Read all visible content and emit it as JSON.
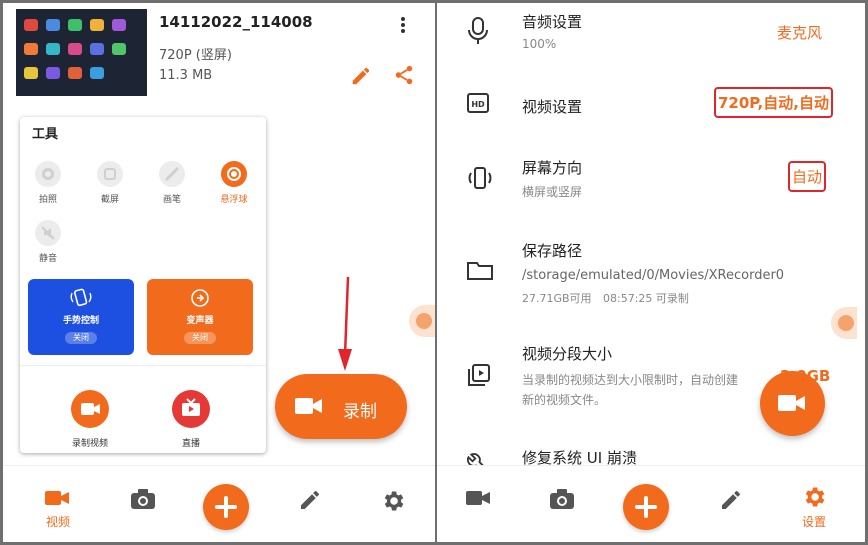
{
  "left": {
    "video": {
      "title": "14112022_114008",
      "resolution": "720P (竖屏)",
      "size": "11.3 MB"
    },
    "tools": {
      "title": "工具",
      "items": [
        {
          "label": "拍照",
          "icon": "camera-shutter-icon",
          "active": false
        },
        {
          "label": "截屏",
          "icon": "screenshot-icon",
          "active": false
        },
        {
          "label": "画笔",
          "icon": "brush-icon",
          "active": false
        },
        {
          "label": "悬浮球",
          "icon": "floating-ball-icon",
          "active": true
        },
        {
          "label": "静音",
          "icon": "mute-icon",
          "active": false
        }
      ],
      "cards": [
        {
          "label": "手势控制",
          "status": "关闭",
          "icon": "gesture-icon",
          "color": "#1d4fe0"
        },
        {
          "label": "变声器",
          "status": "关闭",
          "icon": "voice-changer-icon",
          "color": "#f26b1d"
        }
      ],
      "actions": [
        {
          "label": "录制视频",
          "icon": "record-video-icon",
          "color": "#f26b1d"
        },
        {
          "label": "直播",
          "icon": "live-tv-icon",
          "color": "#e53935"
        }
      ]
    },
    "record_button": {
      "label": "录制"
    },
    "nav": [
      {
        "label": "视频",
        "icon": "video-camera-icon",
        "active": true
      },
      {
        "label": "",
        "icon": "camera-icon",
        "active": false
      },
      {
        "label": "",
        "icon": "plus-icon",
        "active": false
      },
      {
        "label": "",
        "icon": "pencil-icon",
        "active": false
      },
      {
        "label": "",
        "icon": "gear-icon",
        "active": false
      }
    ]
  },
  "right": {
    "settings": [
      {
        "title": "音频设置",
        "subtitle": "100%",
        "value": "麦克风",
        "icon": "microphone-icon"
      },
      {
        "title": "视频设置",
        "subtitle": "",
        "value": "720P,自动,自动",
        "icon": "hd-icon"
      },
      {
        "title": "屏幕方向",
        "subtitle": "横屏或竖屏",
        "value": "自动",
        "icon": "screen-rotation-icon"
      },
      {
        "title": "保存路径",
        "subtitle": "/storage/emulated/0/Movies/XRecorder0",
        "storage_free": "27.71GB可用",
        "record_time": "08:57:25 可录制",
        "icon": "folder-icon"
      },
      {
        "title": "视频分段大小",
        "subtitle": "当录制的视频达到大小限制时，自动创建",
        "subtitle2": "新的视频文件。",
        "value": "2.0GB",
        "icon": "video-segment-icon"
      },
      {
        "title": "修复系统 UI 崩溃",
        "icon": "wrench-icon"
      }
    ],
    "nav": [
      {
        "label": "",
        "icon": "video-camera-icon",
        "active": false
      },
      {
        "label": "",
        "icon": "camera-icon",
        "active": false
      },
      {
        "label": "",
        "icon": "plus-icon",
        "active": false
      },
      {
        "label": "",
        "icon": "pencil-icon",
        "active": false
      },
      {
        "label": "设置",
        "icon": "gear-icon",
        "active": true
      }
    ]
  },
  "colors": {
    "accent": "#f26b1d",
    "highlight_box": "#e0262a",
    "blue_card": "#1d4fe0"
  }
}
